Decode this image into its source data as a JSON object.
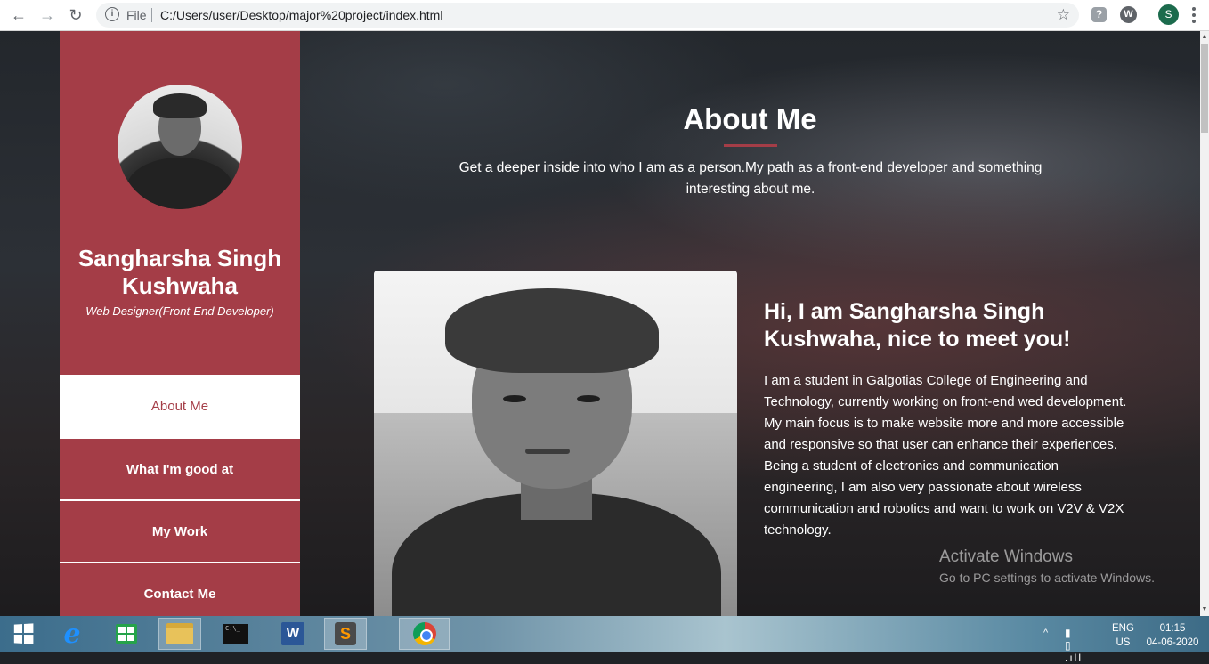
{
  "browser": {
    "back_icon": "←",
    "forward_icon": "→",
    "reload_icon": "↻",
    "info_icon": "i",
    "scheme_label": "File",
    "url": "C:/Users/user/Desktop/major%20project/index.html",
    "star_icon": "☆",
    "ext1_label": "?",
    "ext2_label": "W",
    "profile_initial": "S"
  },
  "sidebar": {
    "name": "Sangharsha Singh Kushwaha",
    "role": "Web Designer(Front-End Developer)",
    "nav": [
      {
        "label": "About Me",
        "active": true
      },
      {
        "label": "What I'm good at",
        "active": false
      },
      {
        "label": "My Work",
        "active": false
      },
      {
        "label": "Contact Me",
        "active": false
      }
    ],
    "accent_color": "#a43d47"
  },
  "main": {
    "title": "About Me",
    "subtitle": "Get a deeper inside into who I am as a person.My path as a front-end developer and something interesting about me.",
    "intro_heading": "Hi, I am Sangharsha Singh Kushwaha, nice to meet you!",
    "intro_paragraphs": [
      "I am a student in Galgotias College of Engineering and Technology, currently working on front-end wed development. My main focus is to make website more and more accessible and responsive so that user can enhance their experiences.",
      "Being a student of electronics and communication engineering, I am also very passionate about wireless communication and robotics and want to work on V2V & V2X technology."
    ]
  },
  "watermark": {
    "title": "Activate Windows",
    "subtitle": "Go to PC settings to activate Windows."
  },
  "taskbar": {
    "cmd_label": "C:\\_",
    "word_label": "W",
    "sublime_label": "S",
    "tray_icons": "▮ ▯ .ıll",
    "show_hidden_icon": "^",
    "language": "ENG",
    "region": "US",
    "time": "01:15",
    "date": "04-06-2020"
  }
}
